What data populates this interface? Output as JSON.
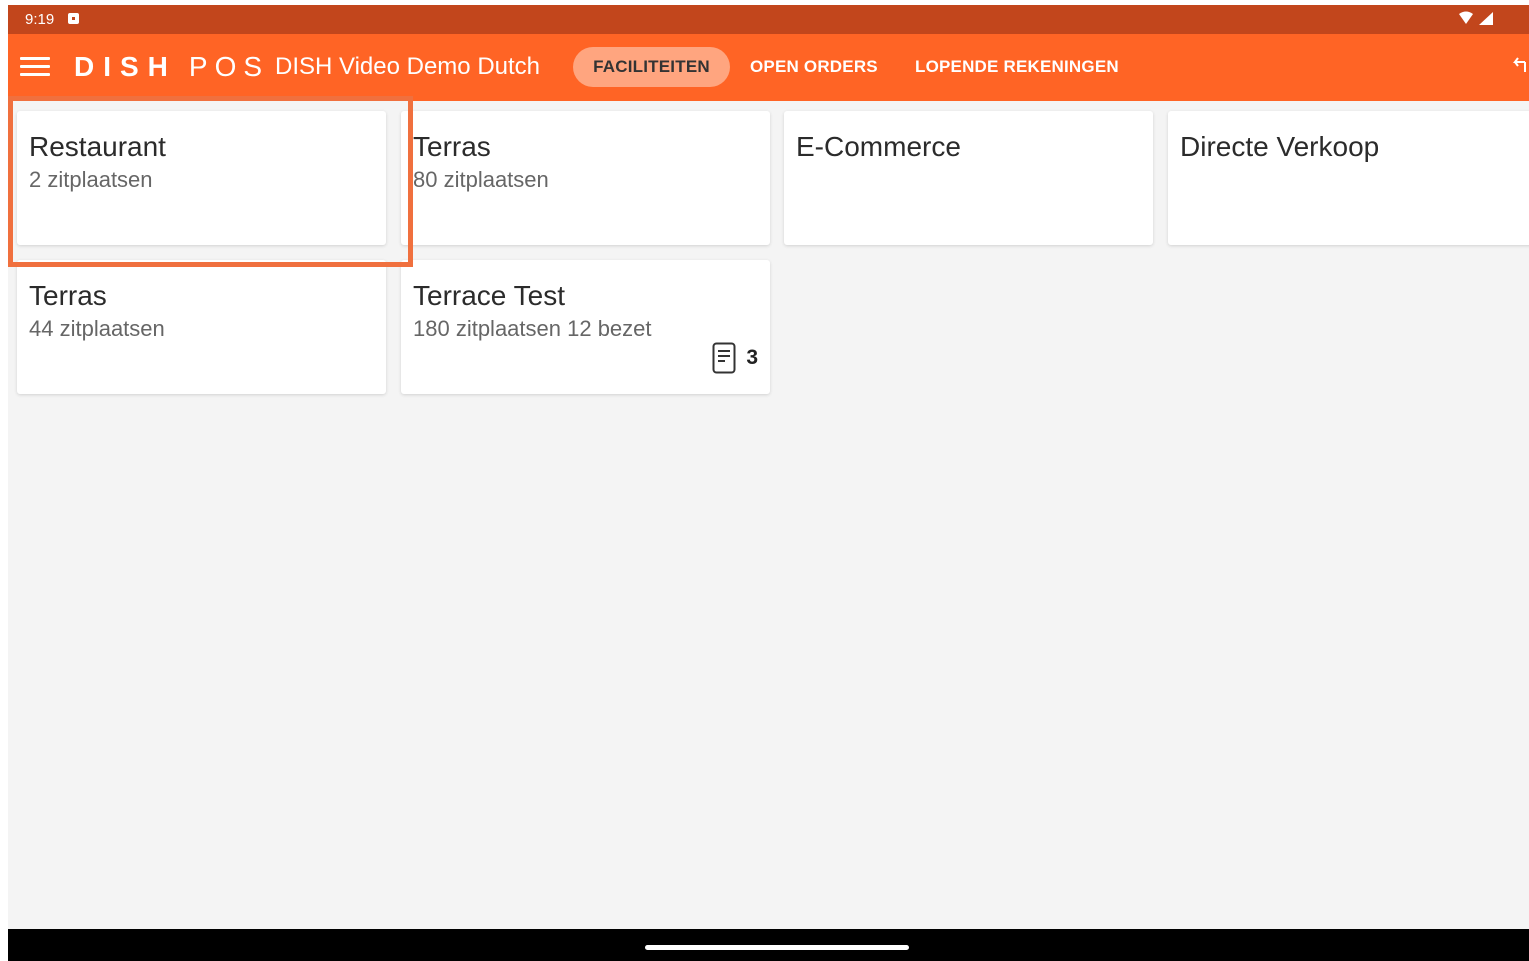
{
  "status_bar": {
    "time": "9:19",
    "icons": [
      "notification-icon",
      "wifi-icon",
      "signal-icon"
    ]
  },
  "app_bar": {
    "brand_part1": "DISH",
    "brand_part2": "POS",
    "venue_name": "DISH Video Demo Dutch",
    "tabs": [
      {
        "label": "FACILITEITEN",
        "active": true
      },
      {
        "label": "OPEN ORDERS",
        "active": false
      },
      {
        "label": "LOPENDE REKENINGEN",
        "active": false
      }
    ],
    "menu_icon": "hamburger-menu-icon",
    "back_icon": "back-arrow-icon"
  },
  "facilities": [
    {
      "name": "Restaurant",
      "seats": "2 zitplaatsen"
    },
    {
      "name": "Terras",
      "seats": "80 zitplaatsen"
    },
    {
      "name": "E-Commerce",
      "seats": ""
    },
    {
      "name": "Directe Verkoop",
      "seats": ""
    },
    {
      "name": "Terras",
      "seats": "44 zitplaatsen"
    },
    {
      "name": "Terrace Test",
      "seats": "180 zitplaatsen 12 bezet",
      "open_orders": "3"
    }
  ],
  "colors": {
    "status_bar": "#c2461c",
    "app_bar": "#ff6425",
    "active_tab": "#ffa57f",
    "highlight": "#f0703e",
    "background": "#f4f4f4"
  }
}
